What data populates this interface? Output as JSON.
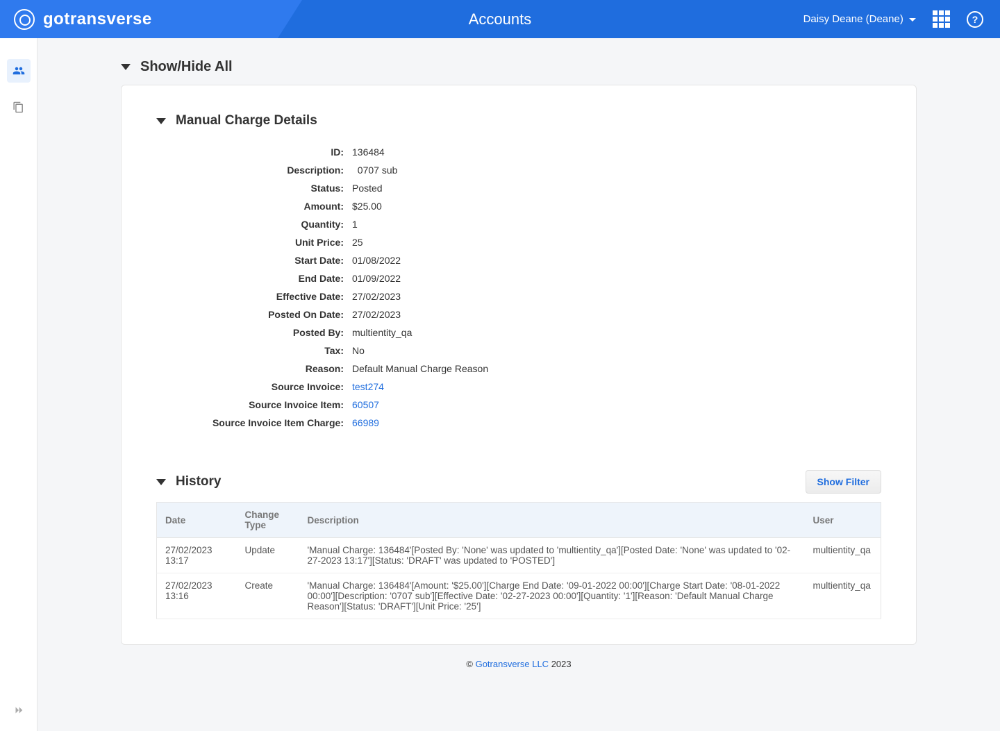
{
  "header": {
    "brand": "gotransverse",
    "page_title": "Accounts",
    "user_label": "Daisy Deane (Deane)"
  },
  "showhide": {
    "title": "Show/Hide All"
  },
  "details": {
    "section_title": "Manual Charge Details",
    "rows": [
      {
        "label": "ID:",
        "value": "136484"
      },
      {
        "label": "Description:",
        "value": "  0707 sub"
      },
      {
        "label": "Status:",
        "value": "Posted"
      },
      {
        "label": "Amount:",
        "value": "$25.00"
      },
      {
        "label": "Quantity:",
        "value": "1"
      },
      {
        "label": "Unit Price:",
        "value": "25"
      },
      {
        "label": "Start Date:",
        "value": "01/08/2022"
      },
      {
        "label": "End Date:",
        "value": "01/09/2022"
      },
      {
        "label": "Effective Date:",
        "value": "27/02/2023"
      },
      {
        "label": "Posted On Date:",
        "value": "27/02/2023"
      },
      {
        "label": "Posted By:",
        "value": "multientity_qa"
      },
      {
        "label": "Tax:",
        "value": "No"
      },
      {
        "label": "Reason:",
        "value": "Default Manual Charge Reason"
      },
      {
        "label": "Source Invoice:",
        "value": "test274",
        "link": true
      },
      {
        "label": "Source Invoice Item:",
        "value": "60507",
        "link": true
      },
      {
        "label": "Source Invoice Item Charge:",
        "value": "66989",
        "link": true
      }
    ]
  },
  "history": {
    "section_title": "History",
    "show_filter": "Show Filter",
    "columns": {
      "date": "Date",
      "type": "Change Type",
      "desc": "Description",
      "user": "User"
    },
    "rows": [
      {
        "date": "27/02/2023 13:17",
        "type": "Update",
        "desc": "'Manual Charge: 136484'[Posted By: 'None' was updated to 'multientity_qa'][Posted Date: 'None' was updated to '02-27-2023 13:17'][Status: 'DRAFT' was updated to 'POSTED']",
        "user": "multientity_qa"
      },
      {
        "date": "27/02/2023 13:16",
        "type": "Create",
        "desc": "'Manual Charge: 136484'[Amount: '$25.00'][Charge End Date: '09-01-2022 00:00'][Charge Start Date: '08-01-2022 00:00'][Description: '0707 sub'][Effective Date: '02-27-2023 00:00'][Quantity: '1'][Reason: 'Default Manual Charge Reason'][Status: 'DRAFT'][Unit Price: '25']",
        "user": "multientity_qa"
      }
    ]
  },
  "footer": {
    "copyright": "©",
    "company": "Gotransverse LLC",
    "year": "2023"
  }
}
